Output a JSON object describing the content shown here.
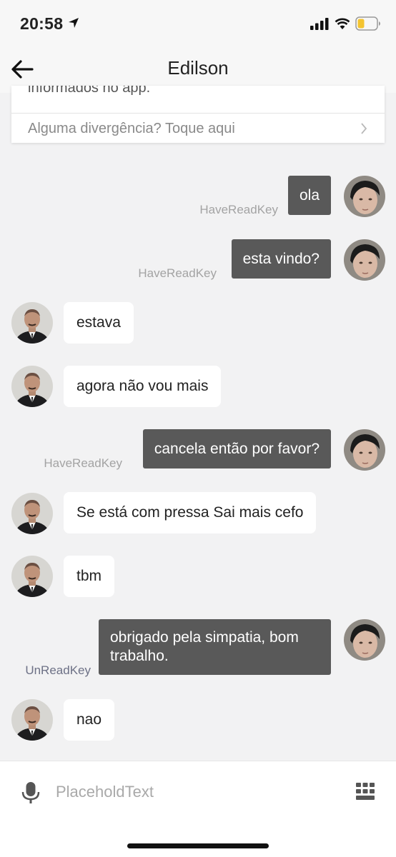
{
  "status_bar": {
    "time": "20:58",
    "battery_color": "#f4c430"
  },
  "header": {
    "title": "Edilson"
  },
  "info_card": {
    "clipped_text": "informados no app.",
    "row_label": "Alguma divergência? Toque aqui"
  },
  "messages": [
    {
      "side": "out",
      "text": "ola",
      "read_label": "HaveReadKey"
    },
    {
      "side": "out",
      "text": "esta vindo?",
      "read_label": "HaveReadKey"
    },
    {
      "side": "in",
      "text": "estava"
    },
    {
      "side": "in",
      "text": "agora não vou mais"
    },
    {
      "side": "out",
      "text": "cancela então por favor?",
      "read_label": "HaveReadKey"
    },
    {
      "side": "in",
      "text": "Se está com pressa Sai mais cefo"
    },
    {
      "side": "in",
      "text": "tbm"
    },
    {
      "side": "out",
      "text": "obrigado pela simpatia, bom trabalho.",
      "read_label": "UnReadKey"
    },
    {
      "side": "in",
      "text": "nao"
    }
  ],
  "input": {
    "placeholder": "PlaceholdText"
  }
}
